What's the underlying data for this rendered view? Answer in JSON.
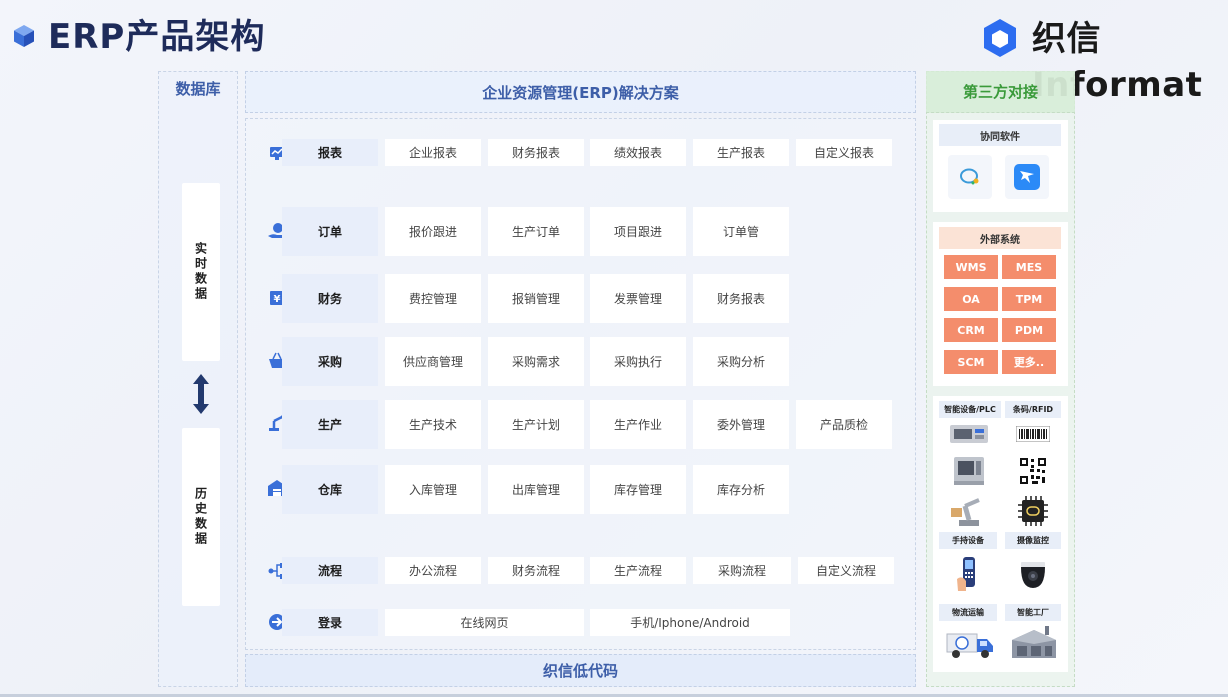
{
  "header": {
    "title": "ERP产品架构",
    "logo_text": "织信 Informat"
  },
  "database": {
    "title": "数据库",
    "realtime_label": "实时数据",
    "history_label": "历史数据"
  },
  "solution": {
    "title": "企业资源管理(ERP)解决方案",
    "footer": "织信低代码"
  },
  "rows": [
    {
      "icon": "report-chart-icon",
      "label": "报表",
      "cells": [
        "企业报表",
        "财务报表",
        "绩效报表",
        "生产报表",
        "自定义报表"
      ]
    },
    {
      "icon": "order-hand-icon",
      "label": "订单",
      "cells": [
        "报价跟进",
        "生产订单",
        "项目跟进",
        "订单管"
      ]
    },
    {
      "icon": "finance-yen-icon",
      "label": "财务",
      "cells": [
        "费控管理",
        "报销管理",
        "发票管理",
        "财务报表"
      ]
    },
    {
      "icon": "purchase-basket-icon",
      "label": "采购",
      "cells": [
        "供应商管理",
        "采购需求",
        "采购执行",
        "采购分析"
      ]
    },
    {
      "icon": "production-robot-arm-icon",
      "label": "生产",
      "cells": [
        "生产技术",
        "生产计划",
        "生产作业",
        "委外管理",
        "产品质检"
      ]
    },
    {
      "icon": "warehouse-icon",
      "label": "仓库",
      "cells": [
        "入库管理",
        "出库管理",
        "库存管理",
        "库存分析"
      ]
    },
    {
      "icon": "process-flow-icon",
      "label": "流程",
      "cells": [
        "办公流程",
        "财务流程",
        "生产流程",
        "采购流程",
        "自定义流程"
      ]
    },
    {
      "icon": "login-arrow-icon",
      "label": "登录",
      "cells": [
        "在线网页",
        "手机/Iphone/Android"
      ]
    }
  ],
  "third_party": {
    "title": "第三方对接",
    "collab_title": "协同软件",
    "collab_icons": [
      "wecom-icon",
      "dingtalk-icon"
    ],
    "external_title": "外部系统",
    "external_systems": [
      "WMS",
      "MES",
      "OA",
      "TPM",
      "CRM",
      "PDM",
      "SCM",
      "更多.."
    ],
    "devices": {
      "plc_label": "智能设备/PLC",
      "rfid_label": "条码/RFID",
      "handheld_label": "手持设备",
      "camera_label": "摄像监控",
      "logistics_label": "物流运输",
      "factory_label": "智能工厂"
    }
  },
  "colors": {
    "accent": "#3d5ea8",
    "title": "#1e2b5a",
    "third_party_green": "#3a9a3a",
    "external_orange": "#f48d6c",
    "icon_blue": "#3a6fd8"
  }
}
